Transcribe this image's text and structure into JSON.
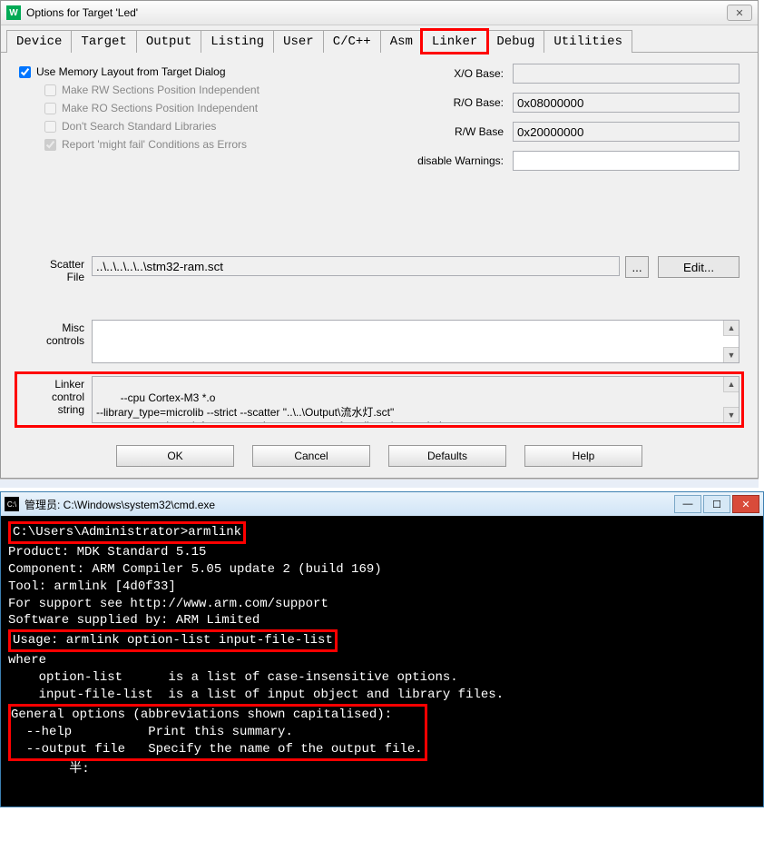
{
  "dialog": {
    "title": "Options for Target 'Led'",
    "tabs": [
      "Device",
      "Target",
      "Output",
      "Listing",
      "User",
      "C/C++",
      "Asm",
      "Linker",
      "Debug",
      "Utilities"
    ],
    "active_tab": "Linker",
    "use_memory_layout": "Use Memory Layout from Target Dialog",
    "make_rw": "Make RW Sections Position Independent",
    "make_ro": "Make RO Sections Position Independent",
    "dont_search": "Don't Search Standard Libraries",
    "report_might_fail": "Report 'might fail' Conditions as Errors",
    "xo_base_label": "X/O Base:",
    "ro_base_label": "R/O Base:",
    "rw_base_label": "R/W Base",
    "disable_warnings_label": "disable Warnings:",
    "xo_base_val": "",
    "ro_base_val": "0x08000000",
    "rw_base_val": "0x20000000",
    "disable_warnings_val": "",
    "scatter_label": "Scatter\nFile",
    "scatter_val": "..\\..\\..\\..\\..\\stm32-ram.sct",
    "browse_btn": "...",
    "edit_btn": "Edit...",
    "misc_label": "Misc\ncontrols",
    "misc_val": "",
    "linker_label": "Linker\ncontrol\nstring",
    "linker_val": "--cpu Cortex-M3 *.o\n--library_type=microlib --strict --scatter \"..\\..\\Output\\流水灯.sct\"\n--summary_stderr --info summarysizes --map --xref --callgraph --symbols",
    "ok_btn": "OK",
    "cancel_btn": "Cancel",
    "defaults_btn": "Defaults",
    "help_btn": "Help"
  },
  "cmd": {
    "title": "管理员: C:\\Windows\\system32\\cmd.exe",
    "prompt_line": "C:\\Users\\Administrator>armlink",
    "lines_after_prompt": "Product: MDK Standard 5.15\nComponent: ARM Compiler 5.05 update 2 (build 169)\nTool: armlink [4d0f33]\nFor support see http://www.arm.com/support\nSoftware supplied by: ARM Limited\n",
    "usage_line": "Usage: armlink option-list input-file-list",
    "where_block": "where\n    option-list      is a list of case-insensitive options.\n    input-file-list  is a list of input object and library files.\n",
    "general_block": "General options (abbreviations shown capitalised):\n  --help          Print this summary.\n  --output file   Specify the name of the output file.",
    "cursor_line": "        半:"
  }
}
